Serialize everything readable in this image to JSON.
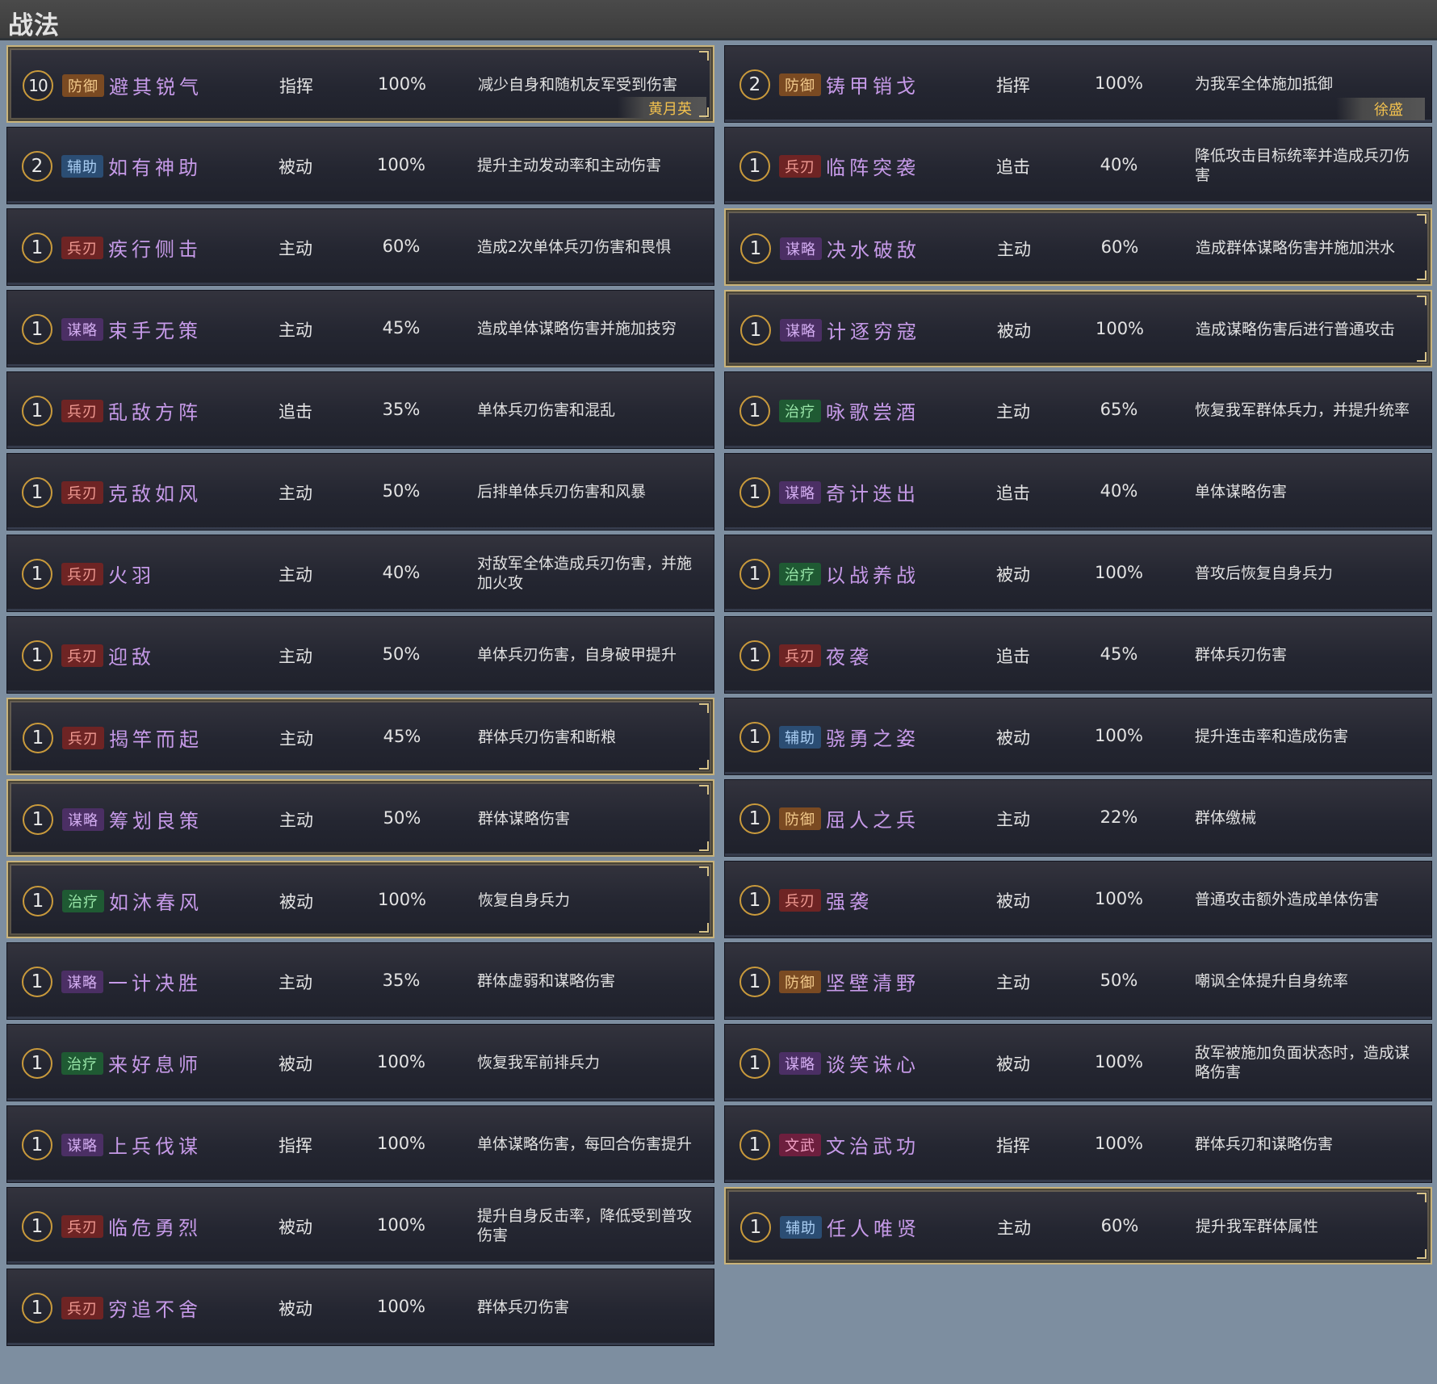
{
  "header": {
    "title": "战法"
  },
  "left": [
    {
      "level": "10",
      "tag": "防御",
      "tagType": "def",
      "name": "避其锐气",
      "type": "指挥",
      "rate": "100%",
      "desc": "减少自身和随机友军受到伤害",
      "owner": "黄月英",
      "highlight": true
    },
    {
      "level": "2",
      "tag": "辅助",
      "tagType": "sup",
      "name": "如有神助",
      "type": "被动",
      "rate": "100%",
      "desc": "提升主动发动率和主动伤害",
      "owner": "",
      "highlight": false
    },
    {
      "level": "1",
      "tag": "兵刃",
      "tagType": "atk",
      "name": "疾行侧击",
      "type": "主动",
      "rate": "60%",
      "desc": "造成2次单体兵刃伤害和畏惧",
      "owner": "",
      "highlight": false
    },
    {
      "level": "1",
      "tag": "谋略",
      "tagType": "stg",
      "name": "束手无策",
      "type": "主动",
      "rate": "45%",
      "desc": "造成单体谋略伤害并施加技穷",
      "owner": "",
      "highlight": false
    },
    {
      "level": "1",
      "tag": "兵刃",
      "tagType": "atk",
      "name": "乱敌方阵",
      "type": "追击",
      "rate": "35%",
      "desc": "单体兵刃伤害和混乱",
      "owner": "",
      "highlight": false
    },
    {
      "level": "1",
      "tag": "兵刃",
      "tagType": "atk",
      "name": "克敌如风",
      "type": "主动",
      "rate": "50%",
      "desc": "后排单体兵刃伤害和风暴",
      "owner": "",
      "highlight": false
    },
    {
      "level": "1",
      "tag": "兵刃",
      "tagType": "atk",
      "name": "火羽",
      "type": "主动",
      "rate": "40%",
      "desc": "对敌军全体造成兵刃伤害，并施加火攻",
      "owner": "",
      "highlight": false
    },
    {
      "level": "1",
      "tag": "兵刃",
      "tagType": "atk",
      "name": "迎敌",
      "type": "主动",
      "rate": "50%",
      "desc": "单体兵刃伤害，自身破甲提升",
      "owner": "",
      "highlight": false
    },
    {
      "level": "1",
      "tag": "兵刃",
      "tagType": "atk",
      "name": "揭竿而起",
      "type": "主动",
      "rate": "45%",
      "desc": "群体兵刃伤害和断粮",
      "owner": "",
      "highlight": true
    },
    {
      "level": "1",
      "tag": "谋略",
      "tagType": "stg",
      "name": "筹划良策",
      "type": "主动",
      "rate": "50%",
      "desc": "群体谋略伤害",
      "owner": "",
      "highlight": true
    },
    {
      "level": "1",
      "tag": "治疗",
      "tagType": "heal",
      "name": "如沐春风",
      "type": "被动",
      "rate": "100%",
      "desc": "恢复自身兵力",
      "owner": "",
      "highlight": true
    },
    {
      "level": "1",
      "tag": "谋略",
      "tagType": "stg",
      "name": "一计决胜",
      "type": "主动",
      "rate": "35%",
      "desc": "群体虚弱和谋略伤害",
      "owner": "",
      "highlight": false
    },
    {
      "level": "1",
      "tag": "治疗",
      "tagType": "heal",
      "name": "来好息师",
      "type": "被动",
      "rate": "100%",
      "desc": "恢复我军前排兵力",
      "owner": "",
      "highlight": false
    },
    {
      "level": "1",
      "tag": "谋略",
      "tagType": "stg",
      "name": "上兵伐谋",
      "type": "指挥",
      "rate": "100%",
      "desc": "单体谋略伤害，每回合伤害提升",
      "owner": "",
      "highlight": false
    },
    {
      "level": "1",
      "tag": "兵刃",
      "tagType": "atk",
      "name": "临危勇烈",
      "type": "被动",
      "rate": "100%",
      "desc": "提升自身反击率，降低受到普攻伤害",
      "owner": "",
      "highlight": false
    },
    {
      "level": "1",
      "tag": "兵刃",
      "tagType": "atk",
      "name": "穷追不舍",
      "type": "被动",
      "rate": "100%",
      "desc": "群体兵刃伤害",
      "owner": "",
      "highlight": false
    }
  ],
  "right": [
    {
      "level": "2",
      "tag": "防御",
      "tagType": "def",
      "name": "铸甲销戈",
      "type": "指挥",
      "rate": "100%",
      "desc": "为我军全体施加抵御",
      "owner": "徐盛",
      "highlight": false
    },
    {
      "level": "1",
      "tag": "兵刃",
      "tagType": "atk",
      "name": "临阵突袭",
      "type": "追击",
      "rate": "40%",
      "desc": "降低攻击目标统率并造成兵刃伤害",
      "owner": "",
      "highlight": false
    },
    {
      "level": "1",
      "tag": "谋略",
      "tagType": "stg",
      "name": "决水破敌",
      "type": "主动",
      "rate": "60%",
      "desc": "造成群体谋略伤害并施加洪水",
      "owner": "",
      "highlight": true
    },
    {
      "level": "1",
      "tag": "谋略",
      "tagType": "stg",
      "name": "计逐穷寇",
      "type": "被动",
      "rate": "100%",
      "desc": "造成谋略伤害后进行普通攻击",
      "owner": "",
      "highlight": true
    },
    {
      "level": "1",
      "tag": "治疗",
      "tagType": "heal",
      "name": "咏歌尝酒",
      "type": "主动",
      "rate": "65%",
      "desc": "恢复我军群体兵力，并提升统率",
      "owner": "",
      "highlight": false
    },
    {
      "level": "1",
      "tag": "谋略",
      "tagType": "stg",
      "name": "奇计迭出",
      "type": "追击",
      "rate": "40%",
      "desc": "单体谋略伤害",
      "owner": "",
      "highlight": false
    },
    {
      "level": "1",
      "tag": "治疗",
      "tagType": "heal",
      "name": "以战养战",
      "type": "被动",
      "rate": "100%",
      "desc": "普攻后恢复自身兵力",
      "owner": "",
      "highlight": false
    },
    {
      "level": "1",
      "tag": "兵刃",
      "tagType": "atk",
      "name": "夜袭",
      "type": "追击",
      "rate": "45%",
      "desc": "群体兵刃伤害",
      "owner": "",
      "highlight": false
    },
    {
      "level": "1",
      "tag": "辅助",
      "tagType": "sup",
      "name": "骁勇之姿",
      "type": "被动",
      "rate": "100%",
      "desc": "提升连击率和造成伤害",
      "owner": "",
      "highlight": false
    },
    {
      "level": "1",
      "tag": "防御",
      "tagType": "def",
      "name": "屈人之兵",
      "type": "主动",
      "rate": "22%",
      "desc": "群体缴械",
      "owner": "",
      "highlight": false
    },
    {
      "level": "1",
      "tag": "兵刃",
      "tagType": "atk",
      "name": "强袭",
      "type": "被动",
      "rate": "100%",
      "desc": "普通攻击额外造成单体伤害",
      "owner": "",
      "highlight": false
    },
    {
      "level": "1",
      "tag": "防御",
      "tagType": "def",
      "name": "坚壁清野",
      "type": "主动",
      "rate": "50%",
      "desc": "嘲讽全体提升自身统率",
      "owner": "",
      "highlight": false
    },
    {
      "level": "1",
      "tag": "谋略",
      "tagType": "stg",
      "name": "谈笑诛心",
      "type": "被动",
      "rate": "100%",
      "desc": "敌军被施加负面状态时，造成谋略伤害",
      "owner": "",
      "highlight": false
    },
    {
      "level": "1",
      "tag": "文武",
      "tagType": "mix",
      "name": "文治武功",
      "type": "指挥",
      "rate": "100%",
      "desc": "群体兵刃和谋略伤害",
      "owner": "",
      "highlight": false
    },
    {
      "level": "1",
      "tag": "辅助",
      "tagType": "sup",
      "name": "任人唯贤",
      "type": "主动",
      "rate": "60%",
      "desc": "提升我军群体属性",
      "owner": "",
      "highlight": true
    }
  ]
}
